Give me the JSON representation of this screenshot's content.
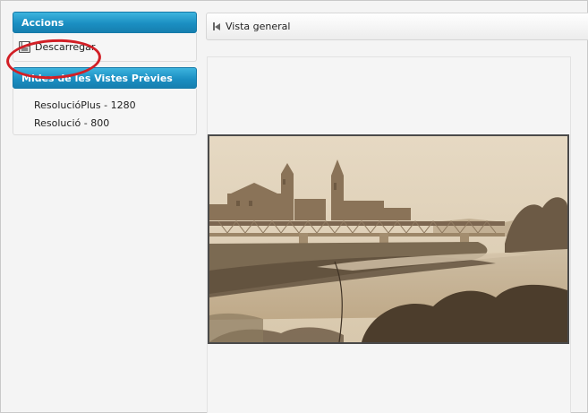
{
  "sidebar": {
    "accions": {
      "title": "Accions",
      "download_label": "Descarregar"
    },
    "mides": {
      "title": "Mides de les Vistes Prèvies",
      "items": [
        {
          "label": "ResolucióPlus - 1280"
        },
        {
          "label": "Resolució - 800"
        }
      ]
    }
  },
  "toolbar": {
    "overview_label": "Vista general"
  },
  "colors": {
    "panel_header": "#1b8fc2",
    "highlight_circle": "#d21f26",
    "photo_sepia": "#c9b79a"
  }
}
